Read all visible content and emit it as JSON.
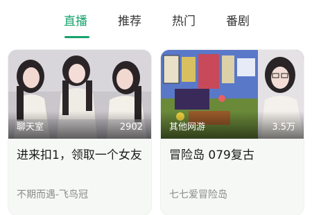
{
  "tabs": [
    {
      "label": "直播",
      "active": true
    },
    {
      "label": "推荐",
      "active": false
    },
    {
      "label": "热门",
      "active": false
    },
    {
      "label": "番剧",
      "active": false
    }
  ],
  "accent_color": "#16a26b",
  "cards": [
    {
      "category": "聊天室",
      "viewers": "2902",
      "title": "进来扣1，领取一个女友",
      "author": "不期而遇-飞鸟冠"
    },
    {
      "category": "其他网游",
      "viewers": "3.5万",
      "title": "冒险岛 079复古",
      "author": "七七爱冒险岛"
    }
  ]
}
